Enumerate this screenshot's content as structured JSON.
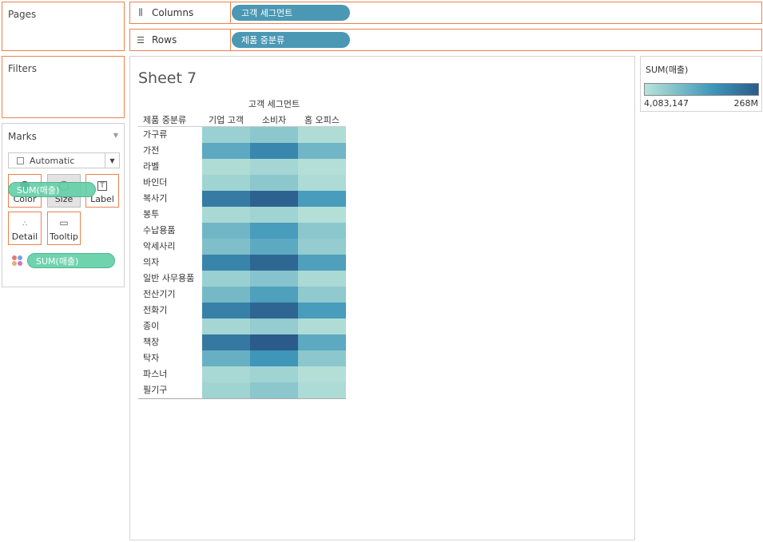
{
  "panels": {
    "pages_title": "Pages",
    "filters_title": "Filters"
  },
  "shelves": {
    "columns": {
      "label": "Columns",
      "icon": "columns-icon",
      "pill": "고객 세그먼트"
    },
    "rows": {
      "label": "Rows",
      "icon": "rows-icon",
      "pill": "제품 중분류"
    }
  },
  "marks": {
    "title": "Marks",
    "mark_type": "Automatic",
    "buttons": {
      "color": "Color",
      "size": "Size",
      "label": "Label",
      "detail": "Detail",
      "tooltip": "Tooltip"
    },
    "dragging_pill": "SUM(매출)",
    "color_pill": "SUM(매출)"
  },
  "sheet": {
    "title": "Sheet 7",
    "column_field": "고객 세그먼트",
    "row_field": "제품 중분류"
  },
  "legend": {
    "title": "SUM(매출)",
    "min_label": "4,083,147",
    "max_label": "268M",
    "color_low": "#b9e3d9",
    "color_high": "#2b5b8a"
  },
  "chart_data": {
    "type": "heatmap",
    "x_title": "고객 세그먼트",
    "y_title": "제품 중분류",
    "columns": [
      "기업 고객",
      "소비자",
      "홈 오피스"
    ],
    "rows": [
      "가구류",
      "가전",
      "라벨",
      "바인더",
      "복사기",
      "봉투",
      "수납용품",
      "악세사리",
      "의자",
      "일반 사무용품",
      "전산기기",
      "전화기",
      "종이",
      "책장",
      "탁자",
      "파스너",
      "필기구"
    ],
    "values": [
      [
        0.15,
        0.22,
        0.05
      ],
      [
        0.45,
        0.7,
        0.35
      ],
      [
        0.05,
        0.1,
        0.03
      ],
      [
        0.12,
        0.22,
        0.06
      ],
      [
        0.78,
        0.95,
        0.55
      ],
      [
        0.08,
        0.12,
        0.03
      ],
      [
        0.35,
        0.55,
        0.22
      ],
      [
        0.28,
        0.45,
        0.18
      ],
      [
        0.72,
        0.92,
        0.52
      ],
      [
        0.15,
        0.25,
        0.07
      ],
      [
        0.33,
        0.52,
        0.2
      ],
      [
        0.75,
        0.93,
        0.55
      ],
      [
        0.1,
        0.18,
        0.05
      ],
      [
        0.8,
        1.0,
        0.45
      ],
      [
        0.4,
        0.6,
        0.22
      ],
      [
        0.08,
        0.12,
        0.03
      ],
      [
        0.12,
        0.22,
        0.06
      ]
    ],
    "value_scale": "relative 0-1 between legend min (4,083,147) and max (268M)",
    "legend_placement": "top-right"
  }
}
